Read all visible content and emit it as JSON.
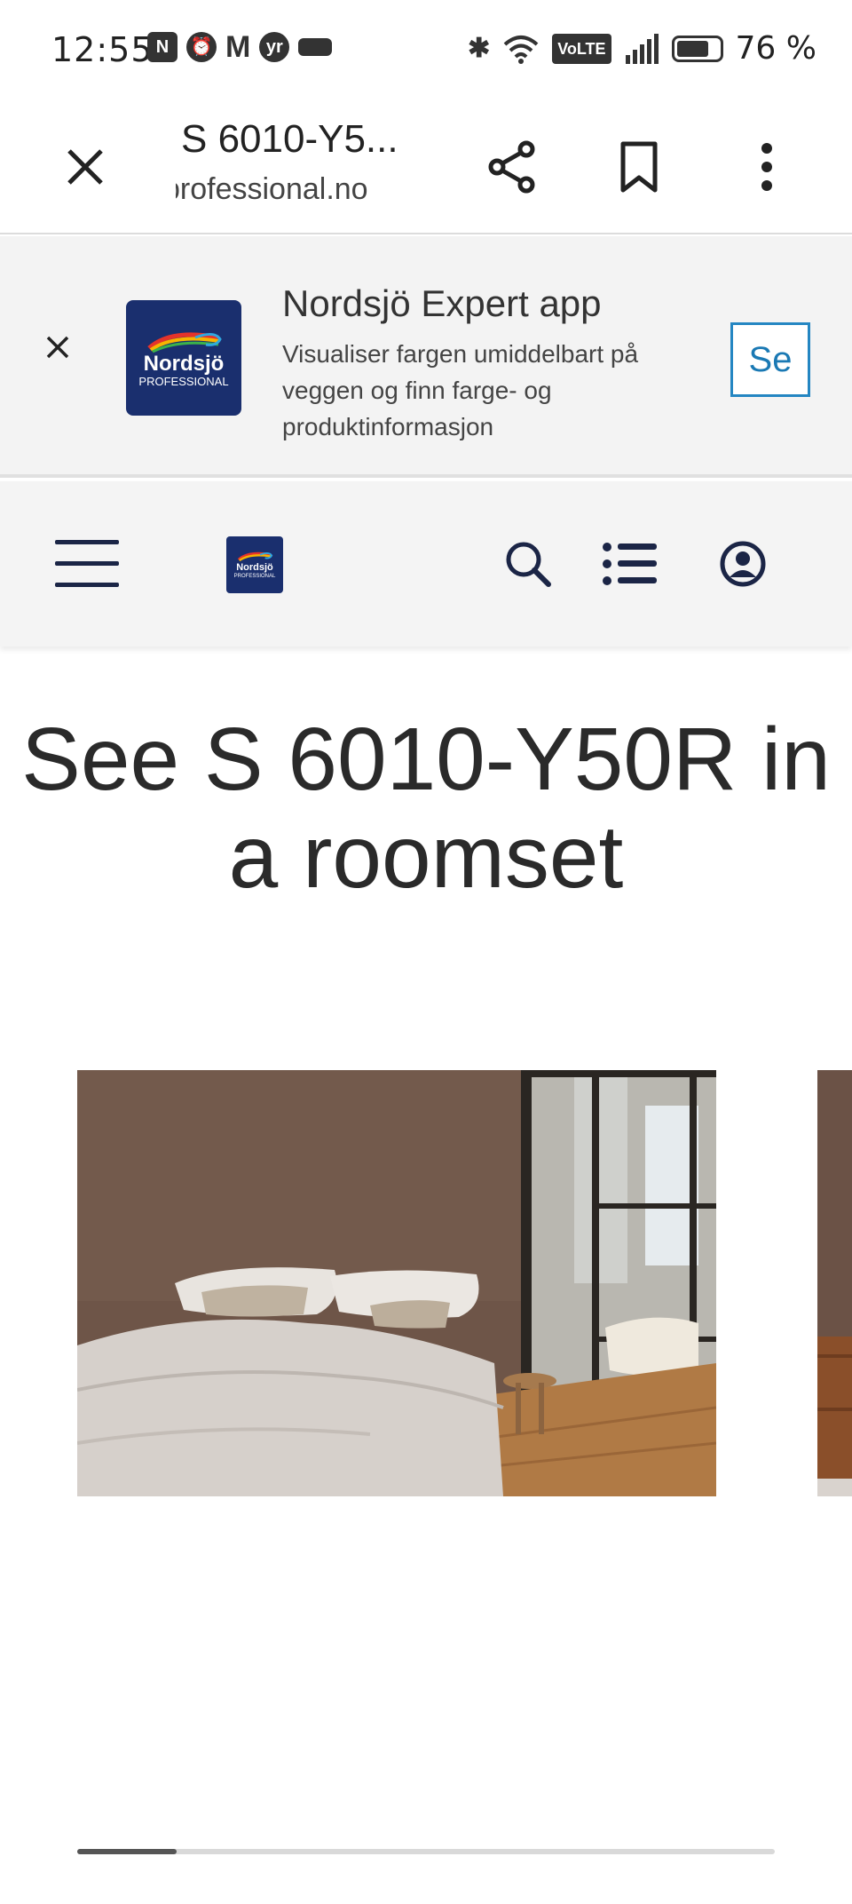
{
  "status_bar": {
    "time": "12:55",
    "left_icons": [
      "nfc-icon",
      "alarm-icon",
      "gmail-icon",
      "yr-icon",
      "notification-icon"
    ],
    "right_icons": [
      "bluetooth-icon",
      "wifi-icon",
      "volte-icon",
      "signal-icon",
      "battery-icon"
    ],
    "volte_label": "VoLTE",
    "battery_percent": "76 %",
    "battery_level": 0.76
  },
  "browser": {
    "page_title": "S 6010-Y5...",
    "url": "professional.no"
  },
  "app_banner": {
    "logo_name": "Nordsjö",
    "logo_sub": "PROFESSIONAL",
    "title": "Nordsjö Expert app",
    "description": "Visualiser fargen umiddelbart på veggen og finn farge- og produktinformasjon",
    "button_label": "Se"
  },
  "site_header": {
    "logo_name": "Nordsjö",
    "logo_sub": "PROFESSIONAL"
  },
  "main": {
    "title": "See S 6010-Y50R in a roomset"
  },
  "carousel": {
    "scroll_fraction": 0.14,
    "colors": {
      "wall": "#6e5548",
      "bedding": "#d9d3ce",
      "floor": "#b07a45",
      "accent_brand": "#1a2f6e",
      "link_blue": "#2486c2"
    }
  }
}
